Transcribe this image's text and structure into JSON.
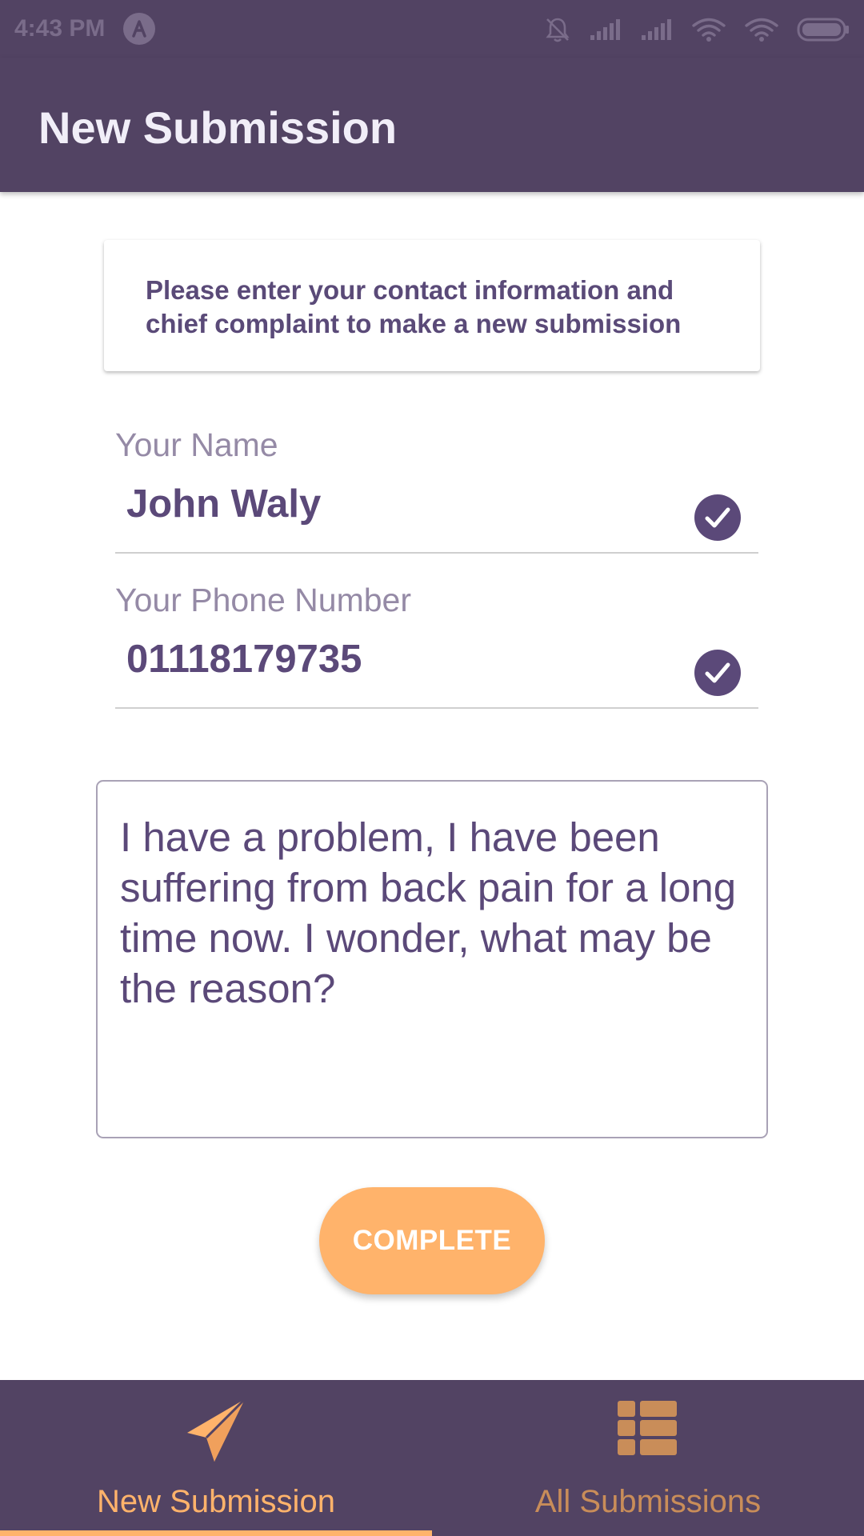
{
  "status_bar": {
    "time": "4:43 PM",
    "icons": [
      "notification-app-icon",
      "mute-bell-icon",
      "signal-icon",
      "signal-icon",
      "wifi-icon",
      "wifi-icon",
      "battery-icon"
    ]
  },
  "app_bar": {
    "title": "New Submission"
  },
  "info_card": {
    "text": "Please enter your contact information and chief complaint to make a new submission"
  },
  "form": {
    "name": {
      "label": "Your Name",
      "value": "John Waly",
      "valid_icon": "check-circle-icon"
    },
    "phone": {
      "label": "Your Phone Number",
      "value": "01118179735",
      "valid_icon": "check-circle-icon"
    },
    "complaint": {
      "value": "I have a problem, I have been suffering from back pain for a long time now. I wonder, what may be the reason?"
    },
    "submit_label": "COMPLETE"
  },
  "bottom_nav": {
    "items": [
      {
        "label": "New Submission",
        "icon": "paper-plane-icon",
        "active": true
      },
      {
        "label": "All Submissions",
        "icon": "list-grid-icon",
        "active": false
      }
    ]
  },
  "colors": {
    "primary": "#524363",
    "accent": "#ffb36b",
    "text_purple": "#5b4979",
    "label_gray": "#958aa6"
  }
}
